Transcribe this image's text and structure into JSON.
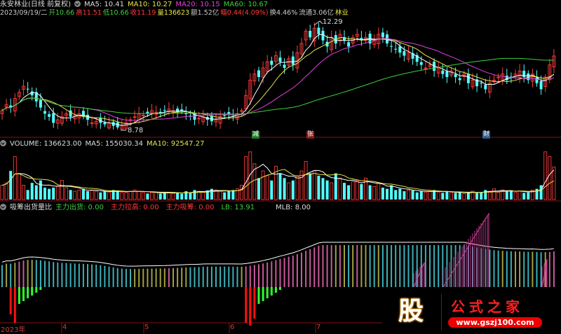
{
  "header": {
    "title": "永安林业(日线 前复权)",
    "ma5": "MA5: 10.41",
    "ma10": "MA10: 10.27",
    "ma20": "MA20: 10.15",
    "ma60": "MA60: 10.67",
    "date": "2023/09/19/二",
    "open_label": "开",
    "open": "10.66",
    "high_label": "高",
    "high": "11.51",
    "low_label": "低",
    "low": "10.66",
    "close_label": "收",
    "close": "11.19",
    "vol_label": "量",
    "vol": "136623",
    "amount": "额1.52亿",
    "chg_label": "幅",
    "chg": "0.44(4.09%)",
    "turnover": "换4.46%",
    "float": "流通3.06亿",
    "industry": "林业"
  },
  "volume_header": {
    "label": "VOLUME: 136623.00",
    "ma5": "MA5: 155030.34",
    "ma10": "MA10: 92547.27"
  },
  "indicator_header": {
    "title": "吸筹出货量比",
    "out": "主力出货: 0.00",
    "pull": "主力拉高: 0.00",
    "absorb": "主力吸筹: 0.00",
    "lb": "LB: 13.91",
    "mlb": "MLB: 8.00"
  },
  "annotations": {
    "max": "12.29",
    "min": "8.78",
    "tag1": "减",
    "tag2": "张",
    "tag3": "财"
  },
  "time_axis": [
    "2023年",
    "4",
    "5",
    "6",
    "7"
  ],
  "watermark": {
    "logo": "股",
    "name": "公式之家",
    "url": "www.gszj100.com"
  },
  "colors": {
    "up": "#ff3a3a",
    "down": "#54ffff",
    "ma5": "#ffffff",
    "ma10": "#e6e64a",
    "ma20": "#e040e0",
    "ma60": "#3cd23c"
  },
  "chart_data": {
    "type": "candlestick",
    "price_range": [
      8.78,
      12.29
    ],
    "close": [
      9.4,
      9.6,
      9.5,
      9.8,
      10.0,
      10.2,
      10.1,
      9.9,
      9.7,
      9.5,
      9.3,
      9.2,
      9.0,
      9.1,
      9.2,
      9.3,
      9.2,
      9.25,
      9.3,
      9.2,
      9.1,
      9.0,
      9.05,
      9.0,
      8.95,
      9.0,
      8.9,
      8.85,
      8.9,
      9.0,
      9.1,
      9.2,
      9.3,
      9.25,
      9.3,
      9.4,
      9.35,
      9.3,
      9.4,
      9.45,
      9.4,
      9.35,
      9.4,
      9.3,
      9.2,
      9.1,
      9.15,
      9.2,
      9.1,
      9.05,
      9.1,
      9.2,
      9.25,
      9.3,
      9.2,
      9.3,
      9.4,
      9.9,
      10.4,
      10.6,
      10.5,
      10.8,
      11.0,
      10.9,
      11.2,
      11.0,
      10.8,
      11.1,
      10.9,
      11.3,
      11.6,
      12.0,
      11.8,
      12.1,
      11.9,
      11.7,
      11.5,
      11.8,
      11.6,
      11.9,
      11.7,
      11.5,
      11.8,
      11.9,
      11.7,
      11.8,
      11.6,
      11.7,
      11.9,
      11.8,
      11.6,
      11.5,
      11.4,
      11.3,
      11.2,
      11.3,
      11.1,
      11.0,
      10.9,
      10.8,
      10.9,
      10.7,
      10.8,
      10.6,
      10.5,
      10.7,
      10.5,
      10.4,
      10.6,
      10.3,
      10.4,
      10.2,
      10.3,
      10.1,
      10.3,
      10.4,
      10.5,
      10.6,
      10.4,
      10.5,
      10.6,
      10.7,
      10.5,
      10.4,
      10.6,
      10.3,
      10.1,
      10.5,
      10.9,
      11.19
    ],
    "volume_k": [
      60,
      70,
      120,
      180,
      110,
      60,
      40,
      70,
      60,
      80,
      50,
      45,
      50,
      55,
      80,
      50,
      40,
      35,
      40,
      45,
      35,
      40,
      35,
      30,
      35,
      30,
      40,
      35,
      30,
      30,
      35,
      40,
      35,
      30,
      25,
      30,
      30,
      25,
      30,
      28,
      26,
      30,
      25,
      35,
      30,
      40,
      35,
      30,
      38,
      45,
      40,
      35,
      30,
      35,
      40,
      45,
      60,
      180,
      200,
      150,
      90,
      120,
      100,
      80,
      140,
      110,
      90,
      70,
      80,
      100,
      120,
      160,
      110,
      120,
      100,
      90,
      80,
      70,
      110,
      90,
      70,
      60,
      75,
      80,
      65,
      90,
      60,
      55,
      70,
      50,
      45,
      60,
      40,
      45,
      35,
      40,
      38,
      30,
      35,
      30,
      35,
      40,
      32,
      28,
      35,
      30,
      28,
      30,
      25,
      30,
      35,
      28,
      30,
      40,
      35,
      45,
      30,
      40,
      35,
      38,
      30,
      35,
      28,
      30,
      40,
      45,
      60,
      200,
      180,
      136.6
    ]
  }
}
